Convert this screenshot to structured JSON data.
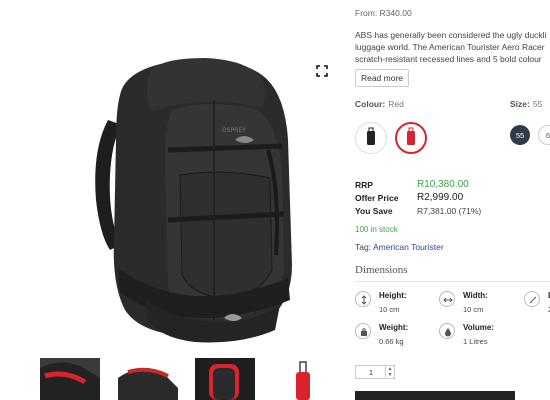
{
  "product": {
    "from_price": "From: R340.00",
    "description_lines": [
      "ABS has generally been considered the ugly duckli",
      "luggage world. The American Tourister Aero Racer",
      "scratch-resistant recessed lines and 5 bold colour"
    ],
    "read_more_label": "Read more",
    "colour_label": "Colour:",
    "colour_value": "Red",
    "size_label": "Size:",
    "size_value": "55",
    "sizes": [
      "55",
      "6"
    ],
    "rrp_label": "RRP",
    "rrp_value": "R10,380.00",
    "offer_label": "Offer Price",
    "offer_value": "R2,999.00",
    "save_label": "You Save",
    "save_value": "R7,381.00 (71%)",
    "stock_status": "100 in stock",
    "tag_label": "Tag:",
    "tag_value": "American Tourister",
    "quantity": "1"
  },
  "dimensions": {
    "title": "Dimensions",
    "specs": [
      {
        "key": "Height:",
        "value": "10 cm",
        "icon": "height-icon"
      },
      {
        "key": "Width:",
        "value": "10 cm",
        "icon": "width-icon"
      },
      {
        "key": "L",
        "value": "2",
        "icon": "length-icon"
      },
      {
        "key": "Weight:",
        "value": "0.66 kg",
        "icon": "weight-icon"
      },
      {
        "key": "Volume:",
        "value": "1 Litres",
        "icon": "volume-icon"
      }
    ]
  },
  "colors": {
    "accent_green": "#3fa24a",
    "link_blue": "#2a4a9a",
    "size_active": "#2f3a4c",
    "swatch_red": "#d9232d"
  },
  "swatches": [
    "black-suitcase",
    "red-suitcase"
  ],
  "thumbnails": [
    "backpack-red-detail-1",
    "backpack-red-detail-2",
    "backpack-interior-red",
    "red-suitcase"
  ]
}
